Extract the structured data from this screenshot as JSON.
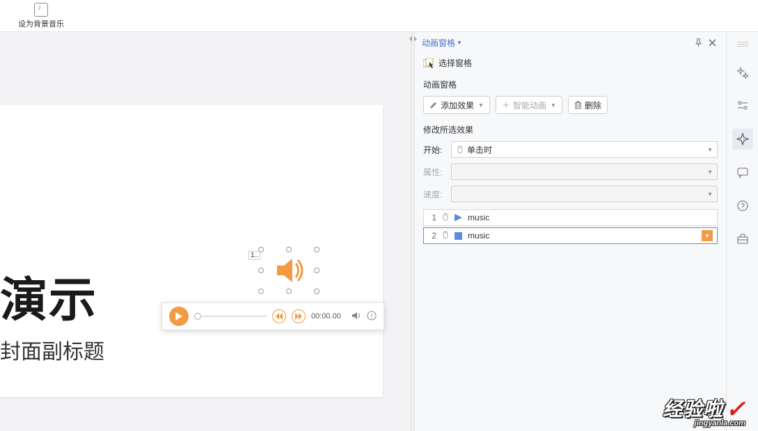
{
  "toolbar": {
    "set_bgm": "设为背景音乐"
  },
  "slide": {
    "title": "演示",
    "subtitle": "封面副标题",
    "obj_tag": "1.."
  },
  "player": {
    "time": "00:00.00"
  },
  "panel": {
    "title": "动画窗格",
    "select_pane": "选择窗格",
    "section": "动画窗格",
    "add_effect": "添加效果",
    "smart_anim": "智能动画",
    "delete": "删除",
    "modify_title": "修改所选效果",
    "start_label": "开始:",
    "start_value": "单击时",
    "prop_label": "属性:",
    "speed_label": "速度:",
    "items": [
      {
        "num": "1",
        "name": "music"
      },
      {
        "num": "2",
        "name": "music"
      }
    ]
  },
  "watermark": {
    "line1": "经验啦",
    "line2": "jingyanla.com"
  }
}
